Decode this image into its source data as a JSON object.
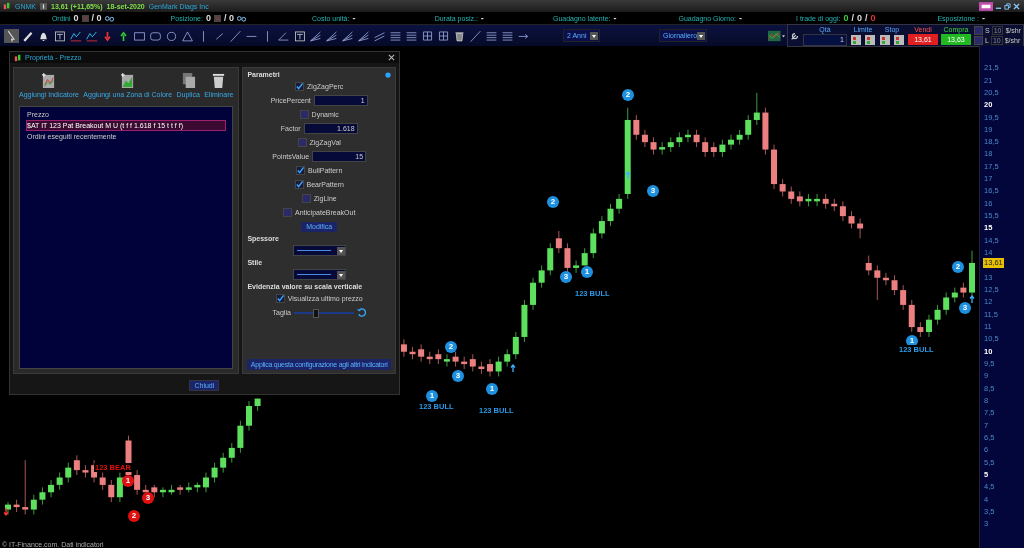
{
  "symbol_bar": {
    "symbol": "GNMK",
    "quote": "13,61 (+11,65%)",
    "date": "18-set-2020",
    "company": "GenMark Diags Inc"
  },
  "stats": [
    {
      "kind": "count",
      "label": "Ordini",
      "value": "0",
      "suffix": "/ 0"
    },
    {
      "kind": "count",
      "label": "Posizione:",
      "value": "0",
      "suffix": "/ 0"
    },
    {
      "kind": "text",
      "label": "Costo unità:",
      "value": "-"
    },
    {
      "kind": "text",
      "label": "Durata posiz.:",
      "value": "-"
    },
    {
      "kind": "text",
      "label": "Guadagno latente:",
      "value": "-"
    },
    {
      "kind": "text",
      "label": "Guadagno Giorno:",
      "value": "-"
    },
    {
      "kind": "trades",
      "label": "I trade di oggi:",
      "parts": [
        {
          "text": "0",
          "color": "#3ec83e"
        },
        {
          "text": "/"
        },
        {
          "text": "0"
        },
        {
          "text": "/"
        },
        {
          "text": "0",
          "color": "#e03030"
        }
      ]
    },
    {
      "kind": "text",
      "label": "Esposizione :",
      "value": "-"
    }
  ],
  "toolbar": {
    "period": "2 Anni",
    "interval": "Giornaliero"
  },
  "order_panel": {
    "qty_label": "Qtà",
    "qty": "1",
    "limit_label": "Limite",
    "stop_label": "Stop",
    "sell_label": "Vendi",
    "sell_price": "13,61",
    "buy_label": "Compra",
    "buy_price": "13,63",
    "options": [
      {
        "label": "S",
        "checked": false,
        "placeholder": "10",
        "unit": "$/shr"
      },
      {
        "label": "L",
        "checked": false,
        "placeholder": "10",
        "unit": "$/shr"
      }
    ]
  },
  "chart": {
    "chart_data": {
      "type": "candlestick",
      "ylim": [
        2,
        22.4
      ],
      "categories": [
        null,
        null,
        null,
        null,
        null,
        null,
        null,
        null,
        null,
        null,
        null,
        null,
        null,
        null,
        null,
        null,
        null,
        null,
        null,
        null,
        null,
        null,
        null,
        null,
        null,
        null,
        null,
        null,
        null,
        null,
        null,
        null,
        null,
        null,
        null,
        null,
        null,
        null,
        null,
        null,
        null,
        null,
        null,
        null,
        null,
        null,
        null,
        null,
        null,
        null,
        null,
        null,
        null,
        null,
        null,
        null,
        null,
        null,
        null,
        null,
        null,
        null,
        null,
        null,
        null,
        null,
        null,
        null,
        null,
        null,
        null,
        null,
        null,
        null,
        null,
        null,
        null,
        null,
        null,
        null,
        null,
        null,
        null,
        null,
        null,
        null,
        null,
        null,
        null,
        null,
        null,
        null,
        null,
        null,
        null,
        null,
        null,
        null,
        null,
        null,
        null,
        null,
        null,
        null,
        null,
        null,
        null,
        null,
        null,
        null,
        null,
        null,
        null
      ],
      "yticks": [
        {
          "value": 21.5,
          "label": "21,5"
        },
        {
          "value": 21,
          "label": "21"
        },
        {
          "value": 20.5,
          "label": "20,5"
        },
        {
          "value": 20,
          "label": "20"
        },
        {
          "value": 19.5,
          "label": "19,5"
        },
        {
          "value": 19,
          "label": "19"
        },
        {
          "value": 18.5,
          "label": "18,5"
        },
        {
          "value": 18,
          "label": "18"
        },
        {
          "value": 17.5,
          "label": "17,5"
        },
        {
          "value": 17,
          "label": "17"
        },
        {
          "value": 16.5,
          "label": "16,5"
        },
        {
          "value": 16,
          "label": "16"
        },
        {
          "value": 15.5,
          "label": "15,5"
        },
        {
          "value": 15,
          "label": "15"
        },
        {
          "value": 14.5,
          "label": "14,5"
        },
        {
          "value": 14,
          "label": "14"
        },
        {
          "value": 13,
          "label": "13"
        },
        {
          "value": 12.5,
          "label": "12,5"
        },
        {
          "value": 12,
          "label": "12"
        },
        {
          "value": 11.5,
          "label": "11,5"
        },
        {
          "value": 11,
          "label": "11"
        },
        {
          "value": 10.5,
          "label": "10,5"
        },
        {
          "value": 10,
          "label": "10"
        },
        {
          "value": 9.5,
          "label": "9,5"
        },
        {
          "value": 9,
          "label": "9"
        },
        {
          "value": 8.5,
          "label": "8,5"
        },
        {
          "value": 8,
          "label": "8"
        },
        {
          "value": 7.5,
          "label": "7,5"
        },
        {
          "value": 7,
          "label": "7"
        },
        {
          "value": 6.5,
          "label": "6,5"
        },
        {
          "value": 6,
          "label": "6"
        },
        {
          "value": 5.5,
          "label": "5,5"
        },
        {
          "value": 5,
          "label": "5"
        },
        {
          "value": 4.5,
          "label": "4,5"
        },
        {
          "value": 4,
          "label": "4"
        },
        {
          "value": 3.5,
          "label": "3,5"
        },
        {
          "value": 3,
          "label": "3"
        }
      ],
      "ohlc": [
        [
          3.6,
          3.9,
          3.4,
          3.8
        ],
        [
          3.8,
          4.0,
          3.5,
          3.7
        ],
        [
          3.7,
          5.6,
          3.4,
          3.6
        ],
        [
          3.6,
          4.2,
          3.4,
          4.0
        ],
        [
          4.0,
          4.5,
          3.8,
          4.3
        ],
        [
          4.3,
          4.8,
          4.1,
          4.6
        ],
        [
          4.6,
          5.1,
          4.4,
          4.9
        ],
        [
          4.9,
          5.5,
          4.7,
          5.3
        ],
        [
          5.6,
          5.8,
          5.0,
          5.2
        ],
        [
          5.2,
          5.4,
          4.9,
          5.1
        ],
        [
          5.4,
          5.6,
          4.7,
          4.9
        ],
        [
          4.9,
          5.1,
          4.4,
          4.6
        ],
        [
          4.6,
          4.8,
          3.9,
          4.1
        ],
        [
          4.1,
          5.1,
          3.9,
          4.9
        ],
        [
          6.4,
          6.6,
          5.0,
          5.0
        ],
        [
          5.0,
          5.2,
          4.2,
          4.4
        ],
        [
          4.4,
          4.6,
          4.3,
          4.3
        ],
        [
          4.5,
          4.6,
          4.1,
          4.3
        ],
        [
          4.3,
          4.5,
          4.1,
          4.4
        ],
        [
          4.3,
          4.6,
          4.2,
          4.4
        ],
        [
          4.5,
          4.6,
          4.2,
          4.4
        ],
        [
          4.4,
          4.7,
          4.3,
          4.5
        ],
        [
          4.5,
          4.7,
          4.3,
          4.6
        ],
        [
          4.5,
          5.1,
          4.3,
          4.9
        ],
        [
          4.9,
          5.5,
          4.7,
          5.3
        ],
        [
          5.3,
          5.9,
          5.1,
          5.7
        ],
        [
          5.7,
          6.3,
          5.5,
          6.1
        ],
        [
          6.1,
          7.2,
          5.9,
          7.0
        ],
        [
          7.0,
          8.0,
          6.8,
          7.8
        ],
        [
          7.8,
          8.1,
          7.6,
          8.1
        ],
        null,
        null,
        null,
        null,
        null,
        null,
        null,
        null,
        null,
        null,
        null,
        null,
        null,
        null,
        null,
        null,
        [
          10.3,
          10.5,
          9.8,
          10.0
        ],
        [
          10.0,
          10.2,
          9.7,
          9.9
        ],
        [
          10.1,
          10.3,
          9.6,
          9.8
        ],
        [
          9.8,
          10.0,
          9.5,
          9.7
        ],
        [
          9.9,
          10.1,
          9.5,
          9.7
        ],
        [
          9.6,
          9.9,
          9.4,
          9.7
        ],
        [
          9.8,
          10.0,
          9.4,
          9.6
        ],
        [
          9.6,
          9.8,
          9.3,
          9.5
        ],
        [
          9.7,
          9.9,
          9.2,
          9.4
        ],
        [
          9.4,
          9.6,
          9.1,
          9.3
        ],
        [
          9.5,
          9.7,
          9.0,
          9.2
        ],
        [
          9.2,
          9.8,
          9.0,
          9.6
        ],
        [
          9.6,
          10.1,
          9.4,
          9.9
        ],
        [
          9.9,
          10.8,
          9.7,
          10.6
        ],
        [
          10.6,
          12.1,
          10.4,
          11.9
        ],
        [
          11.9,
          13.0,
          11.7,
          12.8
        ],
        [
          12.8,
          13.5,
          12.6,
          13.3
        ],
        [
          13.3,
          14.4,
          13.1,
          14.2
        ],
        [
          14.6,
          14.9,
          14.0,
          14.2
        ],
        [
          14.2,
          14.4,
          13.2,
          13.4
        ],
        [
          13.4,
          13.7,
          13.2,
          13.5
        ],
        [
          13.5,
          14.2,
          13.5,
          14.0
        ],
        [
          14.0,
          15.0,
          13.8,
          14.8
        ],
        [
          14.8,
          15.5,
          14.6,
          15.3
        ],
        [
          15.3,
          16.0,
          15.1,
          15.8
        ],
        [
          15.8,
          16.4,
          15.6,
          16.2
        ],
        [
          16.4,
          19.9,
          16.2,
          19.4
        ],
        [
          19.4,
          19.6,
          18.6,
          18.8
        ],
        [
          18.8,
          19.0,
          18.3,
          18.5
        ],
        [
          18.5,
          18.7,
          18.0,
          18.2
        ],
        [
          18.2,
          18.5,
          18.0,
          18.3
        ],
        [
          18.3,
          18.7,
          18.1,
          18.5
        ],
        [
          18.5,
          18.9,
          18.3,
          18.7
        ],
        [
          18.7,
          19.0,
          18.5,
          18.8
        ],
        [
          18.8,
          19.0,
          18.3,
          18.5
        ],
        [
          18.5,
          18.7,
          17.9,
          18.1
        ],
        [
          18.3,
          18.5,
          17.9,
          18.1
        ],
        [
          18.1,
          18.6,
          17.9,
          18.4
        ],
        [
          18.4,
          18.8,
          18.2,
          18.6
        ],
        [
          18.6,
          19.0,
          18.4,
          18.8
        ],
        [
          18.8,
          19.6,
          18.6,
          19.4
        ],
        [
          19.4,
          20.5,
          19.2,
          19.7
        ],
        [
          19.7,
          19.9,
          18.0,
          18.2
        ],
        [
          18.2,
          18.4,
          16.6,
          16.8
        ],
        [
          16.8,
          17.0,
          16.3,
          16.5
        ],
        [
          16.5,
          16.7,
          16.0,
          16.2
        ],
        [
          16.3,
          16.5,
          15.9,
          16.1
        ],
        [
          16.1,
          16.4,
          15.9,
          16.2
        ],
        [
          16.1,
          16.4,
          15.9,
          16.2
        ],
        [
          16.2,
          16.4,
          15.8,
          16.0
        ],
        [
          16.0,
          16.2,
          15.7,
          15.9
        ],
        [
          15.9,
          16.1,
          15.3,
          15.5
        ],
        [
          15.5,
          15.7,
          15.0,
          15.2
        ],
        [
          15.2,
          15.4,
          14.6,
          15.0
        ],
        [
          13.6,
          13.9,
          13.1,
          13.3
        ],
        [
          13.3,
          13.5,
          12.1,
          13.0
        ],
        [
          13.0,
          13.2,
          12.7,
          12.9
        ],
        [
          12.9,
          13.1,
          12.3,
          12.5
        ],
        [
          12.5,
          12.7,
          11.7,
          11.9
        ],
        [
          11.9,
          12.1,
          10.8,
          11.0
        ],
        [
          11.0,
          11.2,
          10.6,
          10.8
        ],
        [
          10.8,
          11.5,
          10.6,
          11.3
        ],
        [
          11.3,
          11.9,
          11.1,
          11.7
        ],
        [
          11.7,
          12.4,
          11.5,
          12.2
        ],
        [
          12.2,
          12.6,
          12.0,
          12.4
        ],
        [
          12.6,
          12.8,
          12.2,
          12.4
        ],
        [
          12.4,
          14.1,
          12.2,
          13.6
        ]
      ]
    },
    "last_price": "13,61",
    "markers": [
      {
        "text": "2",
        "kind": "bull"
      },
      {
        "text": "3",
        "kind": "bull"
      },
      {
        "text": "2",
        "kind": "bull"
      },
      {
        "text": "3",
        "kind": "bull"
      },
      {
        "text": "1",
        "kind": "bull"
      },
      {
        "text": "2",
        "kind": "bull"
      },
      {
        "text": "3",
        "kind": "bull"
      },
      {
        "text": "1",
        "kind": "bull"
      },
      {
        "text": "1",
        "kind": "bull"
      },
      {
        "text": "2",
        "kind": "bull"
      },
      {
        "text": "3",
        "kind": "bull"
      },
      {
        "text": "1",
        "kind": "bull"
      },
      {
        "text": "1",
        "kind": "bear"
      },
      {
        "text": "3",
        "kind": "bear"
      },
      {
        "text": "2",
        "kind": "bear"
      }
    ],
    "pattern_labels": [
      {
        "text": "123 BULL",
        "kind": "bull"
      },
      {
        "text": "123 BULL",
        "kind": "bull"
      },
      {
        "text": "123 BULL",
        "kind": "bull"
      },
      {
        "text": "123 BULL",
        "kind": "bull"
      },
      {
        "text": "123 BEAR",
        "kind": "bear"
      }
    ],
    "footer": "© IT-Finance.com. Dati indicatori"
  },
  "dialog": {
    "title": "Proprietà - Prezzo",
    "actions": [
      "Aggiungi Indicatore",
      "Aggiungi una Zona di Colore",
      "Duplica",
      "Eliminare"
    ],
    "tree": [
      {
        "label": "Prezzo",
        "selected": false
      },
      {
        "label": "$AT IT 123 Pat Breakout M U (t f f 1.618 f 15 t t f f)",
        "selected": true
      },
      {
        "label": "Ordini eseguiti recentemente",
        "selected": false
      }
    ],
    "close_button": "Chiudi",
    "params": {
      "title": "Parametri",
      "items": [
        {
          "kind": "checkbox",
          "label": "ZigZagPerc",
          "checked": true
        },
        {
          "kind": "number",
          "label": "PricePercent",
          "value": "1"
        },
        {
          "kind": "checkbox",
          "label": "Dynamic",
          "checked": false
        },
        {
          "kind": "number",
          "label": "Factor",
          "value": "1.618"
        },
        {
          "kind": "checkbox",
          "label": "ZigZagVal",
          "checked": false
        },
        {
          "kind": "number",
          "label": "PointsValue",
          "value": "15"
        },
        {
          "kind": "checkbox",
          "label": "BullPattern",
          "checked": true
        },
        {
          "kind": "checkbox",
          "label": "BearPattern",
          "checked": true
        },
        {
          "kind": "checkbox",
          "label": "ZigLine",
          "checked": false
        },
        {
          "kind": "checkbox",
          "label": "AnticipateBreakOut",
          "checked": false
        }
      ],
      "modify_button": "Modifica",
      "thickness_label": "Spessore",
      "style_label": "Stile",
      "highlight_title": "Evidenzia valore su scala verticale",
      "show_last_price": {
        "label": "Visualizza ultimo prezzo",
        "checked": true
      },
      "size_label": "Taglia",
      "size": {
        "level": 0.35
      },
      "apply_button": "Applica questa configurazione agli altri indicatori"
    }
  }
}
